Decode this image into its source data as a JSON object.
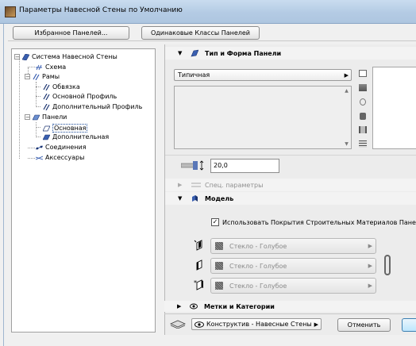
{
  "window": {
    "title": "Параметры Навесной Стены по Умолчанию"
  },
  "toolbar": {
    "favorites_label": "Избранное Панелей...",
    "same_classes_label": "Одинаковые Классы Панелей"
  },
  "tree": {
    "items": [
      {
        "label": "Система Навесной Стены"
      },
      {
        "label": "Схема"
      },
      {
        "label": "Рамы"
      },
      {
        "label": "Обвязка"
      },
      {
        "label": "Основной Профиль"
      },
      {
        "label": "Дополнительный Профиль"
      },
      {
        "label": "Панели"
      },
      {
        "label": "Основная"
      },
      {
        "label": "Дополнительная"
      },
      {
        "label": "Соединения"
      },
      {
        "label": "Аксессуары"
      }
    ]
  },
  "panel": {
    "type_section": {
      "title": "Тип и Форма Панели",
      "type_value": "Типичная"
    },
    "thickness_value": "20,0",
    "special_params": {
      "title": "Спец. параметры"
    },
    "model_section": {
      "title": "Модель",
      "use_materials_label": "Использовать Покрытия Строительных Материалов Панели",
      "use_materials_checked": true,
      "materials": [
        "Стекло - Голубое",
        "Стекло - Голубое",
        "Стекло - Голубое"
      ]
    },
    "labels_section": {
      "title": "Метки и Категории"
    }
  },
  "bottom": {
    "layer_value": "Конструктив - Навесные Стены",
    "cancel_label": "Отменить"
  }
}
